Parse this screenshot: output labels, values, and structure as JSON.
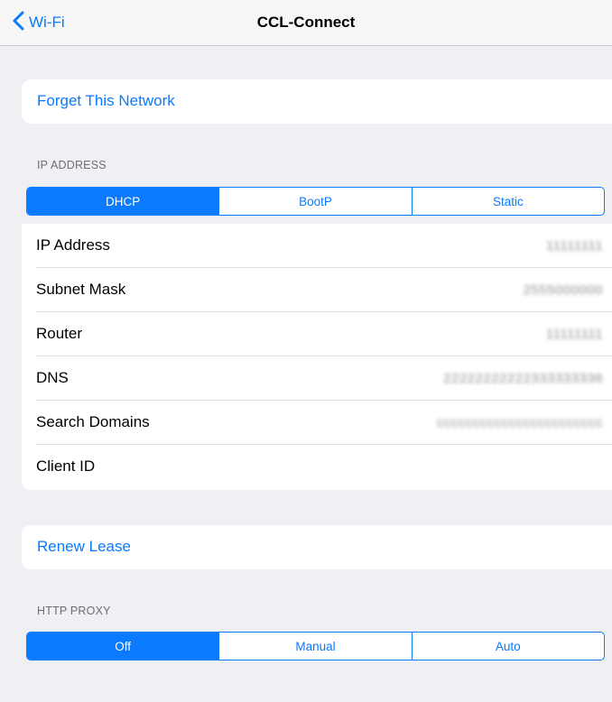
{
  "navbar": {
    "back_label": "Wi-Fi",
    "title": "CCL-Connect"
  },
  "forget_network": {
    "label": "Forget This Network"
  },
  "ip_section": {
    "header": "IP ADDRESS",
    "modes": [
      {
        "label": "DHCP",
        "selected": true
      },
      {
        "label": "BootP",
        "selected": false
      },
      {
        "label": "Static",
        "selected": false
      }
    ],
    "rows": [
      {
        "label": "IP Address",
        "value": "11111111"
      },
      {
        "label": "Subnet Mask",
        "value": "2555000000"
      },
      {
        "label": "Router",
        "value": "11111111"
      },
      {
        "label": "DNS",
        "value": "22222222222333333336"
      },
      {
        "label": "Search Domains",
        "value": "ccccccccccccccccccccccc"
      },
      {
        "label": "Client ID",
        "value": ""
      }
    ]
  },
  "renew_lease": {
    "label": "Renew Lease"
  },
  "proxy_section": {
    "header": "HTTP PROXY",
    "modes": [
      {
        "label": "Off",
        "selected": true
      },
      {
        "label": "Manual",
        "selected": false
      },
      {
        "label": "Auto",
        "selected": false
      }
    ]
  },
  "colors": {
    "accent": "#0a7aff",
    "background": "#efeff4",
    "secondary_text": "#6d6d72"
  }
}
